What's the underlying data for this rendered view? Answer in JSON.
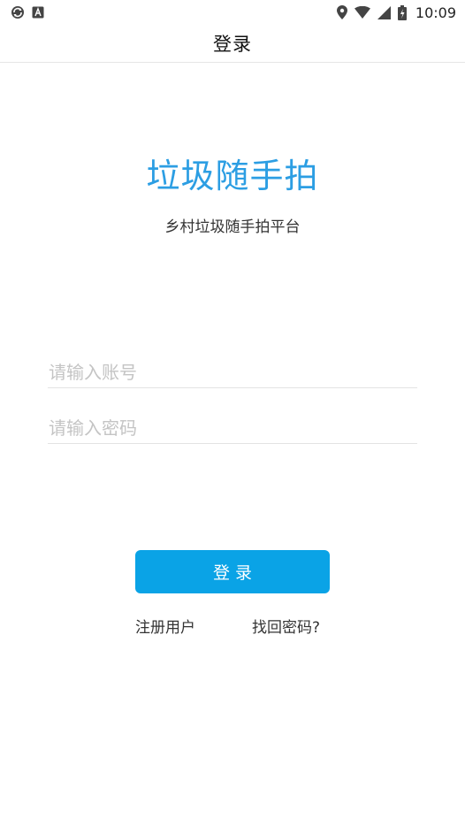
{
  "status_bar": {
    "left_icons": [
      "sync-icon",
      "app-a-icon"
    ],
    "right_icons": [
      "location-icon",
      "wifi-icon",
      "signal-icon",
      "battery-icon"
    ],
    "time": "10:09"
  },
  "header": {
    "title": "登录"
  },
  "hero": {
    "title": "垃圾随手拍",
    "subtitle": "乡村垃圾随手拍平台"
  },
  "form": {
    "account_placeholder": "请输入账号",
    "account_value": "",
    "password_placeholder": "请输入密码",
    "password_value": "",
    "login_label": "登录"
  },
  "links": {
    "register": "注册用户",
    "forgot_password": "找回密码?"
  },
  "colors": {
    "accent": "#2c9ee3",
    "button": "#0aa3e6"
  }
}
